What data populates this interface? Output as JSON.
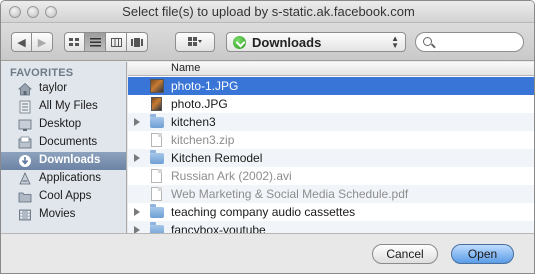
{
  "window": {
    "title": "Select file(s) to upload by s-static.ak.facebook.com"
  },
  "toolbar": {
    "back_icon": "back-arrow-icon",
    "forward_icon": "forward-arrow-icon",
    "view_modes": [
      "icon-view-icon",
      "list-view-icon",
      "column-view-icon",
      "coverflow-view-icon"
    ],
    "arrange_icon": "arrange-grid-icon",
    "location": "Downloads",
    "search_value": ""
  },
  "sidebar": {
    "heading": "FAVORITES",
    "items": [
      {
        "label": "taylor",
        "icon": "home-icon"
      },
      {
        "label": "All My Files",
        "icon": "all-files-icon"
      },
      {
        "label": "Desktop",
        "icon": "desktop-icon"
      },
      {
        "label": "Documents",
        "icon": "documents-icon"
      },
      {
        "label": "Downloads",
        "icon": "downloads-icon",
        "selected": true
      },
      {
        "label": "Applications",
        "icon": "applications-icon"
      },
      {
        "label": "Cool Apps",
        "icon": "folder-icon"
      },
      {
        "label": "Movies",
        "icon": "movies-icon"
      }
    ]
  },
  "filelist": {
    "column_name": "Name",
    "rows": [
      {
        "name": "photo-1.JPG",
        "kind": "photo",
        "selected": true
      },
      {
        "name": "photo.JPG",
        "kind": "photo"
      },
      {
        "name": "kitchen3",
        "kind": "folder"
      },
      {
        "name": "kitchen3.zip",
        "kind": "doc",
        "disabled": true
      },
      {
        "name": "Kitchen Remodel",
        "kind": "folder"
      },
      {
        "name": "Russian Ark (2002).avi",
        "kind": "doc",
        "disabled": true
      },
      {
        "name": "Web Marketing & Social Media Schedule.pdf",
        "kind": "doc",
        "disabled": true
      },
      {
        "name": "teaching company audio cassettes",
        "kind": "folder"
      },
      {
        "name": "fancybox-youtube",
        "kind": "folder"
      }
    ]
  },
  "buttons": {
    "cancel": "Cancel",
    "open": "Open"
  }
}
